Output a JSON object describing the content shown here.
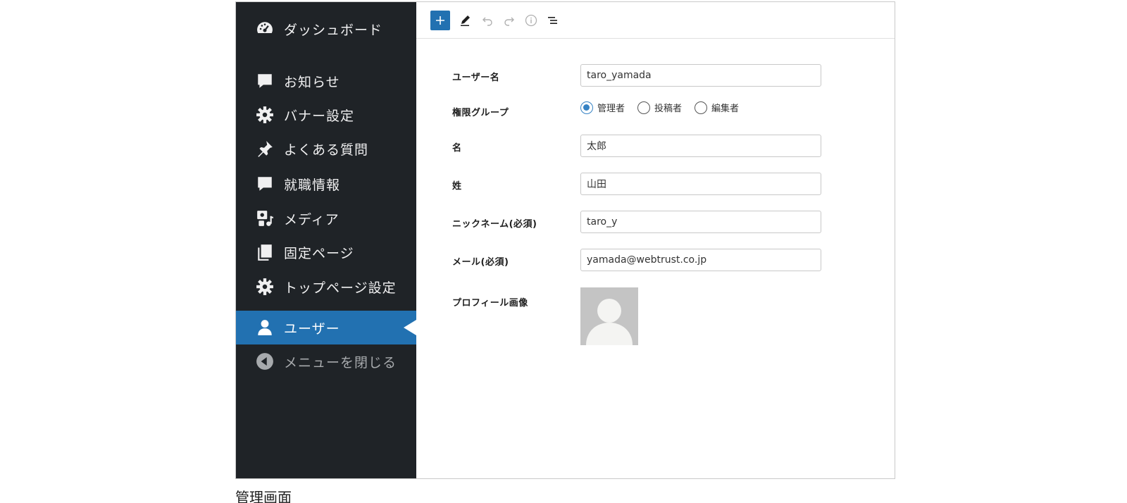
{
  "sidebar": {
    "items": [
      {
        "label": "ダッシュボード",
        "icon": "dashboard-icon"
      },
      {
        "label": "お知らせ",
        "icon": "comment-icon"
      },
      {
        "label": "バナー設定",
        "icon": "gear-icon"
      },
      {
        "label": "よくある質問",
        "icon": "pin-icon"
      },
      {
        "label": "就職情報",
        "icon": "comment-icon"
      },
      {
        "label": "メディア",
        "icon": "media-icon"
      },
      {
        "label": "固定ページ",
        "icon": "pages-icon"
      },
      {
        "label": "トップページ設定",
        "icon": "gear-icon"
      },
      {
        "label": "ユーザー",
        "icon": "user-icon",
        "active": true
      },
      {
        "label": "メニューを閉じる",
        "icon": "collapse-icon"
      }
    ]
  },
  "toolbar": {
    "buttons": [
      "add-icon",
      "pencil-icon",
      "undo-icon",
      "redo-icon",
      "info-icon",
      "list-view-icon"
    ]
  },
  "form": {
    "username": {
      "label": "ユーザー名",
      "value": "taro_yamada"
    },
    "role": {
      "label": "権限グループ",
      "options": [
        "管理者",
        "投稿者",
        "編集者"
      ],
      "selected": "管理者"
    },
    "first_name": {
      "label": "名",
      "value": "太郎"
    },
    "last_name": {
      "label": "姓",
      "value": "山田"
    },
    "nickname": {
      "label": "ニックネーム(必須)",
      "value": "taro_y"
    },
    "email": {
      "label": "メール(必須)",
      "value": "yamada@webtrust.co.jp"
    },
    "profile_image": {
      "label": "プロフィール画像"
    }
  },
  "colors": {
    "sidebar_bg": "#1f2327",
    "accent": "#2271b1",
    "radio_checked": "#3582c4"
  },
  "caption": "管理画面"
}
